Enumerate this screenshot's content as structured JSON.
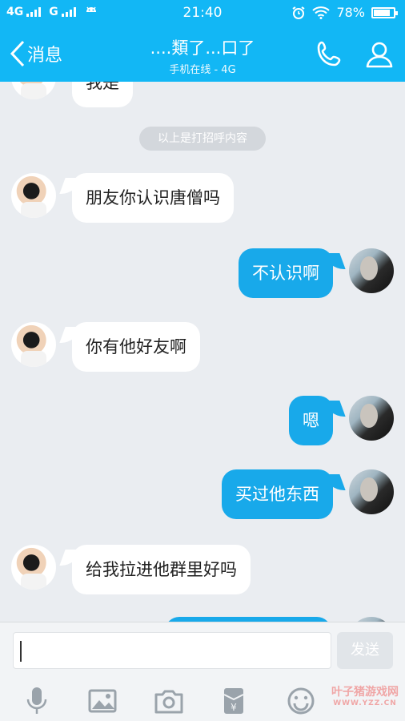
{
  "status_bar": {
    "network1": "4G",
    "network2": "G",
    "time": "21:40",
    "battery": "78%"
  },
  "header": {
    "back_label": "消息",
    "title": "....類了...口了",
    "subtitle": "手机在线 - 4G",
    "accent": "#12b7f5"
  },
  "chat": {
    "partial_top": "我是",
    "system_notice": "以上是打招呼内容",
    "messages": [
      {
        "side": "in",
        "text": "朋友你认识唐僧吗"
      },
      {
        "side": "out",
        "text": "不认识啊"
      },
      {
        "side": "in",
        "text": "你有他好友啊"
      },
      {
        "side": "out",
        "text": "嗯"
      },
      {
        "side": "out",
        "text": "买过他东西"
      },
      {
        "side": "in",
        "text": "给我拉进他群里好吗"
      }
    ]
  },
  "input": {
    "value": "",
    "send_label": "发送"
  },
  "toolbar": {
    "icons": [
      "microphone-icon",
      "image-icon",
      "camera-icon",
      "red-packet-icon",
      "emoji-icon"
    ]
  },
  "watermark": {
    "line1": "叶子猪游戏网",
    "line2": "WWW.YZZ.CN"
  }
}
